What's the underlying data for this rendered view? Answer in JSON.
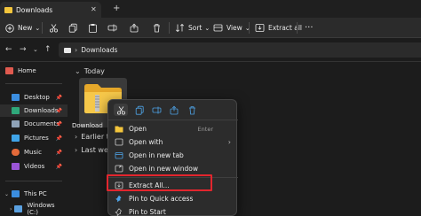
{
  "tab": {
    "title": "Downloads",
    "close": "✕",
    "new_tab": "+"
  },
  "toolbar": {
    "new_label": "New",
    "sort_label": "Sort",
    "view_label": "View",
    "extract_all_label": "Extract all",
    "more": "···",
    "chevron": "⌄"
  },
  "address": {
    "path": "Downloads"
  },
  "sidebar": {
    "items": [
      {
        "label": "Home",
        "color": "#e05a4f"
      },
      {
        "label": "Desktop",
        "color": "#3b8ee0",
        "pinned": true
      },
      {
        "label": "Downloads",
        "color": "#2fa87a",
        "pinned": true
      },
      {
        "label": "Documents",
        "color": "#8fa3b8",
        "pinned": true
      },
      {
        "label": "Pictures",
        "color": "#3fa4e8",
        "pinned": true
      },
      {
        "label": "Music",
        "color": "#e36a3a",
        "pinned": true
      },
      {
        "label": "Videos",
        "color": "#9a55d6",
        "pinned": true
      },
      {
        "label": "This PC",
        "color": "#3b8ee0"
      },
      {
        "label": "Windows (C:)",
        "color": "#5aa0e0"
      }
    ]
  },
  "content": {
    "groups": [
      "Today",
      "Earlier th",
      "Last week"
    ],
    "file": {
      "name": "Download"
    }
  },
  "context_menu": {
    "items": [
      {
        "label": "Open",
        "shortcut": "Enter"
      },
      {
        "label": "Open with",
        "submenu": "›"
      },
      {
        "label": "Open in new tab"
      },
      {
        "label": "Open in new window"
      },
      {
        "label": "Extract All..."
      },
      {
        "label": "Pin to Quick access"
      },
      {
        "label": "Pin to Start"
      }
    ]
  },
  "colors": {
    "highlight": "#e3262e",
    "folder": "#f3c53c",
    "accent": "#4ea3e6"
  }
}
